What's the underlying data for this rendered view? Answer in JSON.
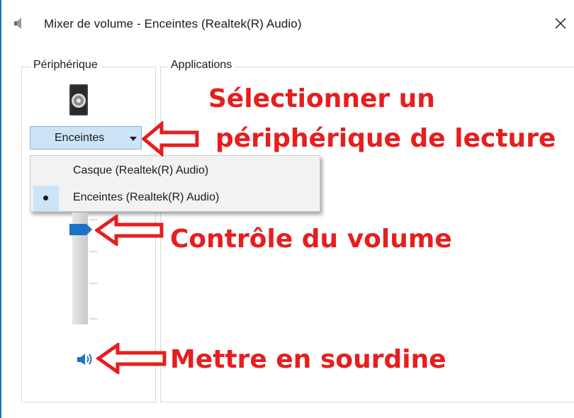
{
  "window": {
    "title": "Mixer de volume - Enceintes (Realtek(R) Audio)",
    "icon": "speaker-icon",
    "close_glyph": "✕"
  },
  "device_group": {
    "legend": "Périphérique",
    "selected_device": "Enceintes",
    "dropdown_items": [
      {
        "label": "Casque (Realtek(R) Audio)",
        "selected": false
      },
      {
        "label": "Enceintes (Realtek(R) Audio)",
        "selected": true
      }
    ],
    "volume_level": 0.9,
    "muted": false
  },
  "apps_group": {
    "legend": "Applications"
  },
  "annotations": {
    "select_line1": "Sélectionner un",
    "select_line2": "périphérique de lecture",
    "volume": "Contrôle du volume",
    "mute": "Mettre en sourdine"
  },
  "colors": {
    "accent": "#1a73c8",
    "selection": "#cce4f7",
    "annotation": "#e61e1e"
  }
}
